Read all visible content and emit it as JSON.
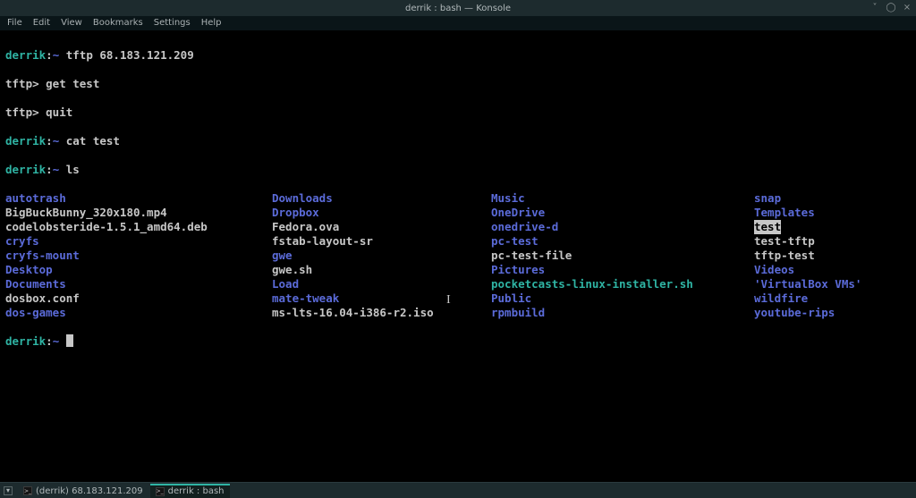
{
  "titlebar": {
    "title": "derrik : bash — Konsole"
  },
  "menubar": [
    "File",
    "Edit",
    "View",
    "Bookmarks",
    "Settings",
    "Help"
  ],
  "prompt": {
    "host": "derrik",
    "path": "~",
    "sep": ":"
  },
  "lines": {
    "l1_cmd": "tftp 68.183.121.209",
    "l2": "tftp> get test",
    "l3": "tftp> quit",
    "l4_cmd": "cat test",
    "l5_cmd": "ls"
  },
  "ls": {
    "col1": [
      {
        "n": "autotrash",
        "t": "dir"
      },
      {
        "n": "BigBuckBunny_320x180.mp4",
        "t": "file"
      },
      {
        "n": "codelobsteride-1.5.1_amd64.deb",
        "t": "file"
      },
      {
        "n": "cryfs",
        "t": "dir"
      },
      {
        "n": "cryfs-mount",
        "t": "dir"
      },
      {
        "n": "Desktop",
        "t": "dir"
      },
      {
        "n": "Documents",
        "t": "dir"
      },
      {
        "n": "dosbox.conf",
        "t": "file"
      },
      {
        "n": "dos-games",
        "t": "dir"
      }
    ],
    "col2": [
      {
        "n": "Downloads",
        "t": "dir"
      },
      {
        "n": "Dropbox",
        "t": "dir"
      },
      {
        "n": "Fedora.ova",
        "t": "file"
      },
      {
        "n": "fstab-layout-sr",
        "t": "file"
      },
      {
        "n": "gwe",
        "t": "dir"
      },
      {
        "n": "gwe.sh",
        "t": "file"
      },
      {
        "n": "Load",
        "t": "dir"
      },
      {
        "n": "mate-tweak",
        "t": "dir"
      },
      {
        "n": "ms-lts-16.04-i386-r2.iso",
        "t": "file"
      }
    ],
    "col3": [
      {
        "n": "Music",
        "t": "dir"
      },
      {
        "n": "OneDrive",
        "t": "dir"
      },
      {
        "n": "onedrive-d",
        "t": "dir"
      },
      {
        "n": "pc-test",
        "t": "dir"
      },
      {
        "n": "pc-test-file",
        "t": "file"
      },
      {
        "n": "Pictures",
        "t": "dir"
      },
      {
        "n": "pocketcasts-linux-installer.sh",
        "t": "exe"
      },
      {
        "n": "Public",
        "t": "dir"
      },
      {
        "n": "rpmbuild",
        "t": "dir"
      }
    ],
    "col4": [
      {
        "n": "snap",
        "t": "dir"
      },
      {
        "n": "Templates",
        "t": "dir"
      },
      {
        "n": "test",
        "t": "highlight"
      },
      {
        "n": "test-tftp",
        "t": "file"
      },
      {
        "n": "tftp-test",
        "t": "file"
      },
      {
        "n": "Videos",
        "t": "dir"
      },
      {
        "n": "'VirtualBox VMs'",
        "t": "dir"
      },
      {
        "n": "wildfire",
        "t": "dir"
      },
      {
        "n": "youtube-rips",
        "t": "dir"
      }
    ]
  },
  "taskbar": {
    "item1": "(derrik) 68.183.121.209",
    "item2": "derrik : bash"
  }
}
